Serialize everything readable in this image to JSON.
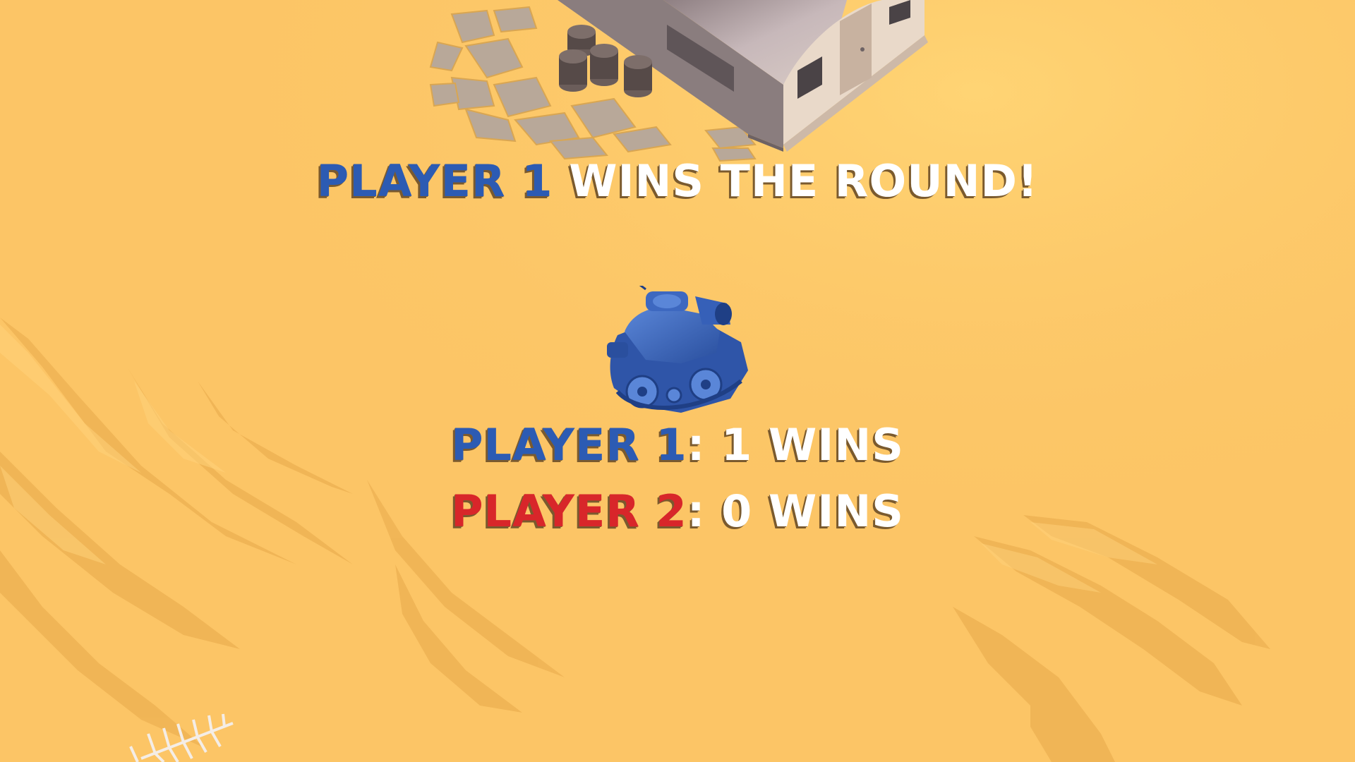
{
  "round_banner": {
    "winner_label": "PLAYER 1",
    "suffix": " WINS THE ROUND!"
  },
  "scoreboard": {
    "player1": {
      "label": "PLAYER 1",
      "separator": ":",
      "score_text": " 1 WINS",
      "wins": 1
    },
    "player2": {
      "label": "PLAYER 2",
      "separator": ":",
      "score_text": " 0 WINS",
      "wins": 0
    }
  },
  "colors": {
    "sand": "#FCC566",
    "player1": "#2C5BB3",
    "player2": "#D8262A",
    "text": "#FFFFFF"
  },
  "icons": {
    "winner_tank": "blue-tank-icon",
    "building": "quonset-hut",
    "barrels": "oil-barrels",
    "skeleton": "fish-skeleton"
  }
}
